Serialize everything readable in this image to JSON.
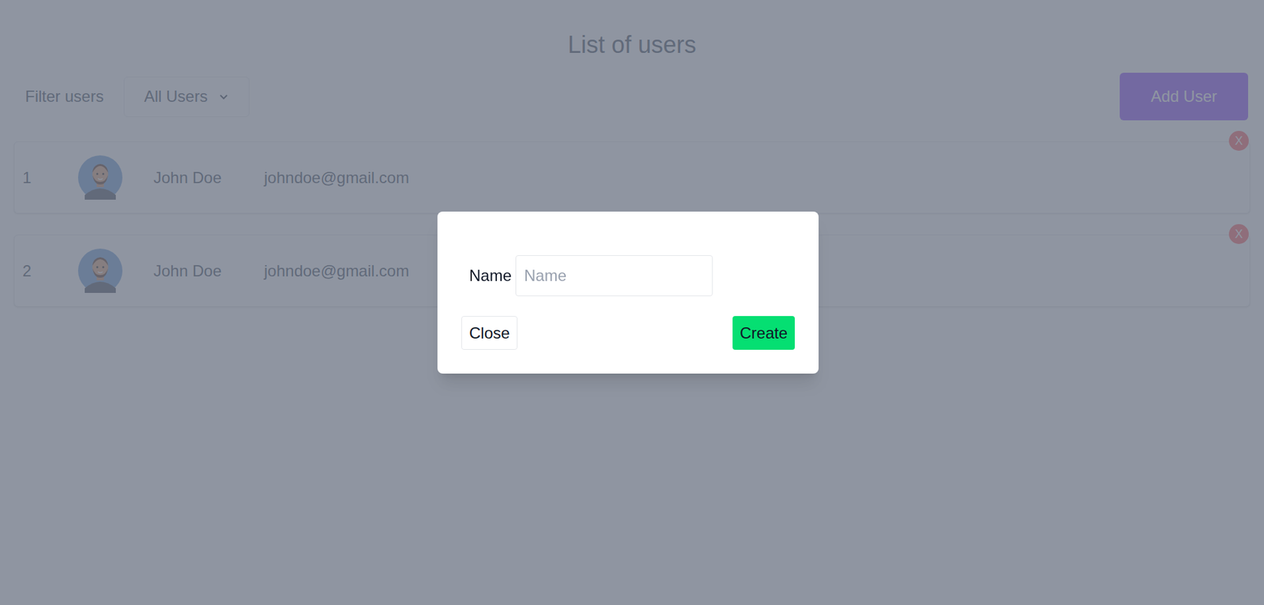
{
  "page": {
    "title": "List of users",
    "filter": {
      "label": "Filter users",
      "value": "All Users"
    },
    "add_button": "Add User"
  },
  "users": [
    {
      "number": "1",
      "name": "John Doe",
      "email": "johndoe@gmail.com",
      "delete": "X"
    },
    {
      "number": "2",
      "name": "John Doe",
      "email": "johndoe@gmail.com",
      "delete": "X"
    }
  ],
  "modal": {
    "open": true,
    "fields": [
      {
        "label": "Name",
        "placeholder": "Name",
        "value": ""
      }
    ],
    "buttons": [
      {
        "label": "Close",
        "kind": "secondary"
      },
      {
        "label": "Create",
        "kind": "primary"
      }
    ]
  }
}
